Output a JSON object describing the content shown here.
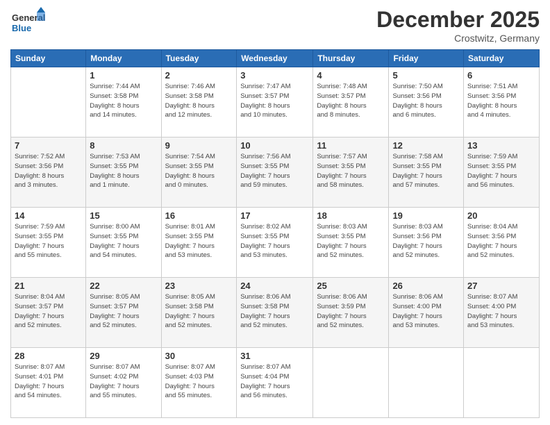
{
  "logo": {
    "general": "General",
    "blue": "Blue"
  },
  "header": {
    "month_title": "December 2025",
    "location": "Crostwitz, Germany"
  },
  "weekdays": [
    "Sunday",
    "Monday",
    "Tuesday",
    "Wednesday",
    "Thursday",
    "Friday",
    "Saturday"
  ],
  "weeks": [
    [
      {
        "day": "",
        "info": ""
      },
      {
        "day": "1",
        "info": "Sunrise: 7:44 AM\nSunset: 3:58 PM\nDaylight: 8 hours\nand 14 minutes."
      },
      {
        "day": "2",
        "info": "Sunrise: 7:46 AM\nSunset: 3:58 PM\nDaylight: 8 hours\nand 12 minutes."
      },
      {
        "day": "3",
        "info": "Sunrise: 7:47 AM\nSunset: 3:57 PM\nDaylight: 8 hours\nand 10 minutes."
      },
      {
        "day": "4",
        "info": "Sunrise: 7:48 AM\nSunset: 3:57 PM\nDaylight: 8 hours\nand 8 minutes."
      },
      {
        "day": "5",
        "info": "Sunrise: 7:50 AM\nSunset: 3:56 PM\nDaylight: 8 hours\nand 6 minutes."
      },
      {
        "day": "6",
        "info": "Sunrise: 7:51 AM\nSunset: 3:56 PM\nDaylight: 8 hours\nand 4 minutes."
      }
    ],
    [
      {
        "day": "7",
        "info": "Sunrise: 7:52 AM\nSunset: 3:56 PM\nDaylight: 8 hours\nand 3 minutes."
      },
      {
        "day": "8",
        "info": "Sunrise: 7:53 AM\nSunset: 3:55 PM\nDaylight: 8 hours\nand 1 minute."
      },
      {
        "day": "9",
        "info": "Sunrise: 7:54 AM\nSunset: 3:55 PM\nDaylight: 8 hours\nand 0 minutes."
      },
      {
        "day": "10",
        "info": "Sunrise: 7:56 AM\nSunset: 3:55 PM\nDaylight: 7 hours\nand 59 minutes."
      },
      {
        "day": "11",
        "info": "Sunrise: 7:57 AM\nSunset: 3:55 PM\nDaylight: 7 hours\nand 58 minutes."
      },
      {
        "day": "12",
        "info": "Sunrise: 7:58 AM\nSunset: 3:55 PM\nDaylight: 7 hours\nand 57 minutes."
      },
      {
        "day": "13",
        "info": "Sunrise: 7:59 AM\nSunset: 3:55 PM\nDaylight: 7 hours\nand 56 minutes."
      }
    ],
    [
      {
        "day": "14",
        "info": "Sunrise: 7:59 AM\nSunset: 3:55 PM\nDaylight: 7 hours\nand 55 minutes."
      },
      {
        "day": "15",
        "info": "Sunrise: 8:00 AM\nSunset: 3:55 PM\nDaylight: 7 hours\nand 54 minutes."
      },
      {
        "day": "16",
        "info": "Sunrise: 8:01 AM\nSunset: 3:55 PM\nDaylight: 7 hours\nand 53 minutes."
      },
      {
        "day": "17",
        "info": "Sunrise: 8:02 AM\nSunset: 3:55 PM\nDaylight: 7 hours\nand 53 minutes."
      },
      {
        "day": "18",
        "info": "Sunrise: 8:03 AM\nSunset: 3:55 PM\nDaylight: 7 hours\nand 52 minutes."
      },
      {
        "day": "19",
        "info": "Sunrise: 8:03 AM\nSunset: 3:56 PM\nDaylight: 7 hours\nand 52 minutes."
      },
      {
        "day": "20",
        "info": "Sunrise: 8:04 AM\nSunset: 3:56 PM\nDaylight: 7 hours\nand 52 minutes."
      }
    ],
    [
      {
        "day": "21",
        "info": "Sunrise: 8:04 AM\nSunset: 3:57 PM\nDaylight: 7 hours\nand 52 minutes."
      },
      {
        "day": "22",
        "info": "Sunrise: 8:05 AM\nSunset: 3:57 PM\nDaylight: 7 hours\nand 52 minutes."
      },
      {
        "day": "23",
        "info": "Sunrise: 8:05 AM\nSunset: 3:58 PM\nDaylight: 7 hours\nand 52 minutes."
      },
      {
        "day": "24",
        "info": "Sunrise: 8:06 AM\nSunset: 3:58 PM\nDaylight: 7 hours\nand 52 minutes."
      },
      {
        "day": "25",
        "info": "Sunrise: 8:06 AM\nSunset: 3:59 PM\nDaylight: 7 hours\nand 52 minutes."
      },
      {
        "day": "26",
        "info": "Sunrise: 8:06 AM\nSunset: 4:00 PM\nDaylight: 7 hours\nand 53 minutes."
      },
      {
        "day": "27",
        "info": "Sunrise: 8:07 AM\nSunset: 4:00 PM\nDaylight: 7 hours\nand 53 minutes."
      }
    ],
    [
      {
        "day": "28",
        "info": "Sunrise: 8:07 AM\nSunset: 4:01 PM\nDaylight: 7 hours\nand 54 minutes."
      },
      {
        "day": "29",
        "info": "Sunrise: 8:07 AM\nSunset: 4:02 PM\nDaylight: 7 hours\nand 55 minutes."
      },
      {
        "day": "30",
        "info": "Sunrise: 8:07 AM\nSunset: 4:03 PM\nDaylight: 7 hours\nand 55 minutes."
      },
      {
        "day": "31",
        "info": "Sunrise: 8:07 AM\nSunset: 4:04 PM\nDaylight: 7 hours\nand 56 minutes."
      },
      {
        "day": "",
        "info": ""
      },
      {
        "day": "",
        "info": ""
      },
      {
        "day": "",
        "info": ""
      }
    ]
  ]
}
